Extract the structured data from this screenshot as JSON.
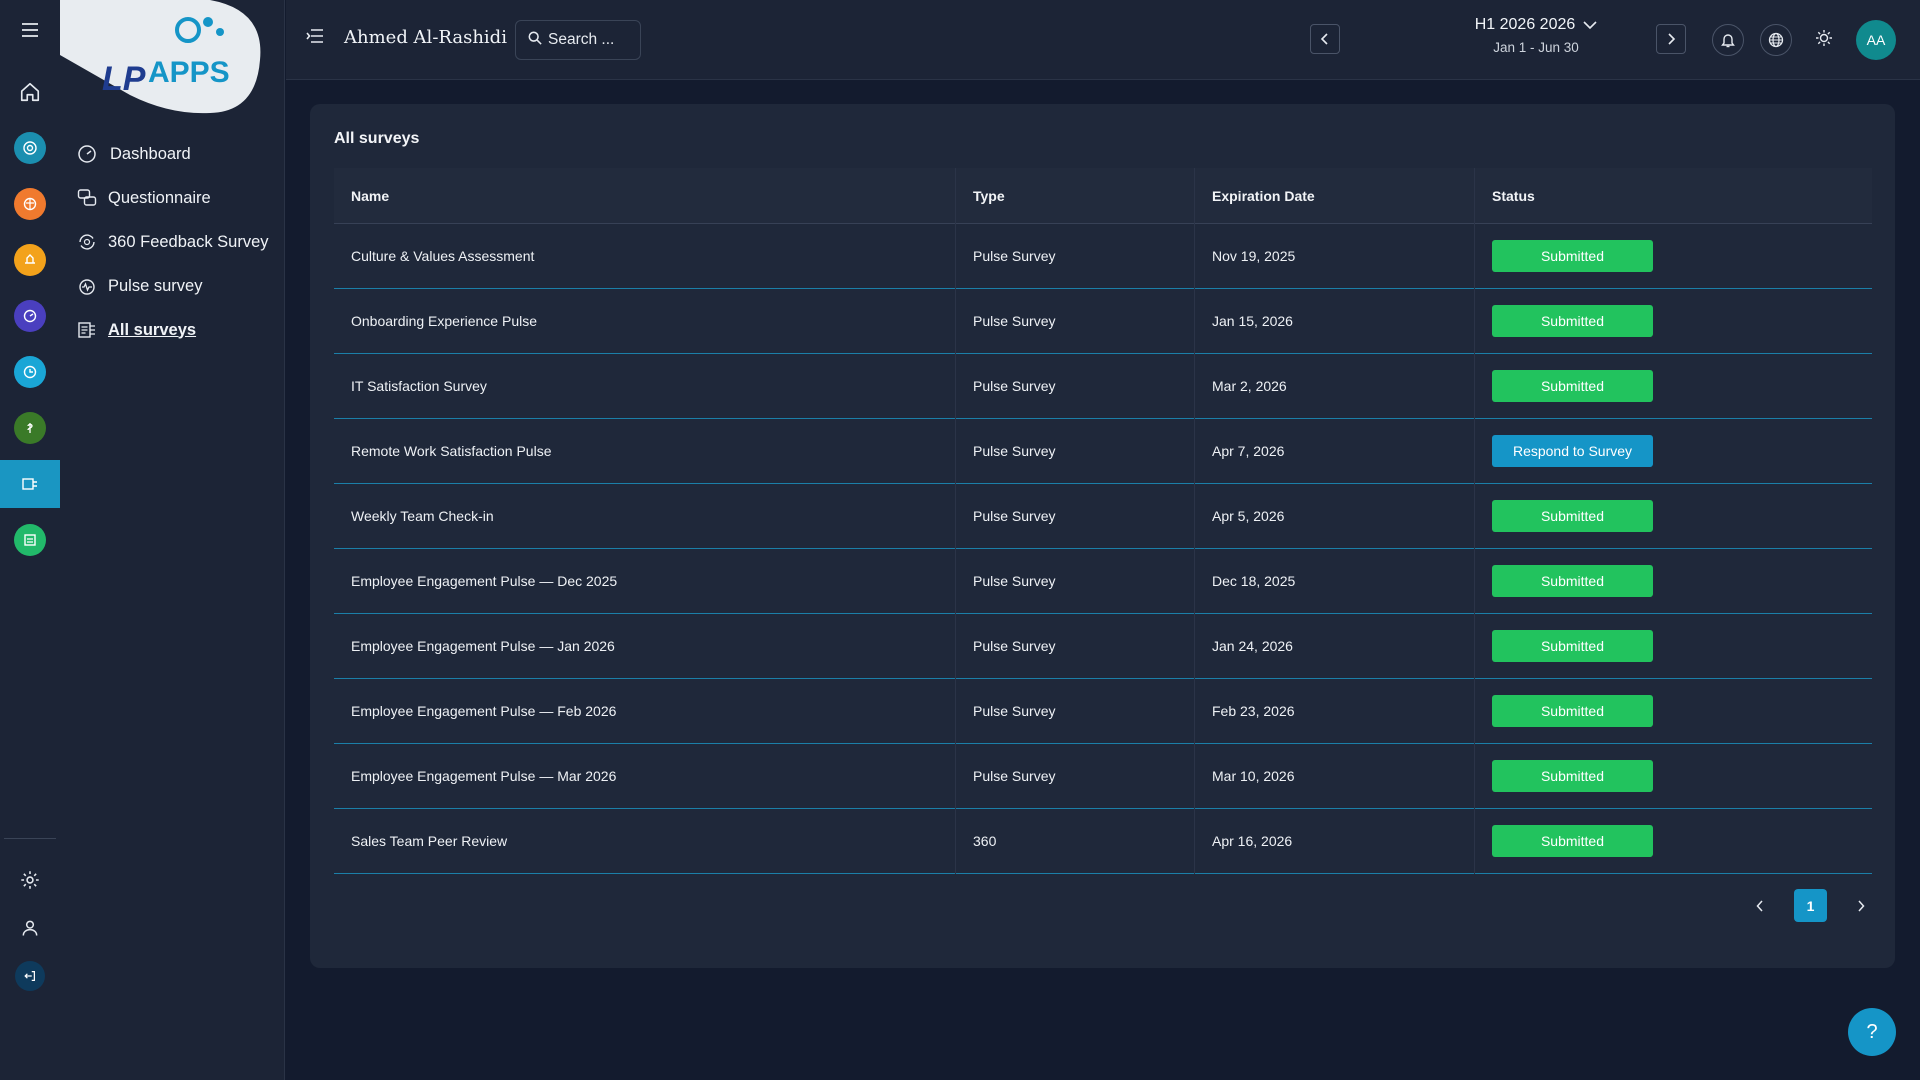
{
  "app": {
    "logo_text": "APPS",
    "logo_mark": "LP"
  },
  "sidebar": {
    "items": [
      {
        "label": "Dashboard",
        "icon": "dashboard-gauge-icon"
      },
      {
        "label": "Questionnaire",
        "icon": "questionnaire-chat-icon"
      },
      {
        "label": "360 Feedback Survey",
        "icon": "feedback-360-icon"
      },
      {
        "label": "Pulse survey",
        "icon": "pulse-survey-icon"
      },
      {
        "label": "All surveys",
        "icon": "all-surveys-icon",
        "active": true
      }
    ]
  },
  "rail": {
    "module_colors": [
      "#1b8fb0",
      "#f07a2e",
      "#f3a21b",
      "#4a3fbf",
      "#1aa6d6",
      "#3a7a28",
      "#22b96a"
    ]
  },
  "header": {
    "user_name": "Ahmed Al-Rashidi",
    "search_placeholder": "Search ...",
    "period_title": "H1 2026 2026",
    "period_range": "Jan 1 - Jun 30",
    "avatar_initials": "AA"
  },
  "main": {
    "title": "All surveys",
    "columns": [
      "Name",
      "Type",
      "Expiration Date",
      "Status"
    ],
    "rows": [
      {
        "name": "Culture & Values Assessment",
        "type": "Pulse Survey",
        "expiration": "Nov 19, 2025",
        "status": "Submitted"
      },
      {
        "name": "Onboarding Experience Pulse",
        "type": "Pulse Survey",
        "expiration": "Jan 15, 2026",
        "status": "Submitted"
      },
      {
        "name": "IT Satisfaction Survey",
        "type": "Pulse Survey",
        "expiration": "Mar 2, 2026",
        "status": "Submitted"
      },
      {
        "name": "Remote Work Satisfaction Pulse",
        "type": "Pulse Survey",
        "expiration": "Apr 7, 2026",
        "status": "Respond to Survey"
      },
      {
        "name": "Weekly Team Check-in",
        "type": "Pulse Survey",
        "expiration": "Apr 5, 2026",
        "status": "Submitted"
      },
      {
        "name": "Employee Engagement Pulse — Dec 2025",
        "type": "Pulse Survey",
        "expiration": "Dec 18, 2025",
        "status": "Submitted"
      },
      {
        "name": "Employee Engagement Pulse — Jan 2026",
        "type": "Pulse Survey",
        "expiration": "Jan 24, 2026",
        "status": "Submitted"
      },
      {
        "name": "Employee Engagement Pulse — Feb 2026",
        "type": "Pulse Survey",
        "expiration": "Feb 23, 2026",
        "status": "Submitted"
      },
      {
        "name": "Employee Engagement Pulse — Mar 2026",
        "type": "Pulse Survey",
        "expiration": "Mar 10, 2026",
        "status": "Submitted"
      },
      {
        "name": "Sales Team Peer Review",
        "type": "360",
        "expiration": "Apr 16, 2026",
        "status": "Submitted"
      }
    ],
    "pagination": {
      "current_page": "1"
    }
  },
  "help_label": "?",
  "colors": {
    "submitted": "#22c35e",
    "respond": "#1595c7",
    "accent": "#1a96c2"
  }
}
